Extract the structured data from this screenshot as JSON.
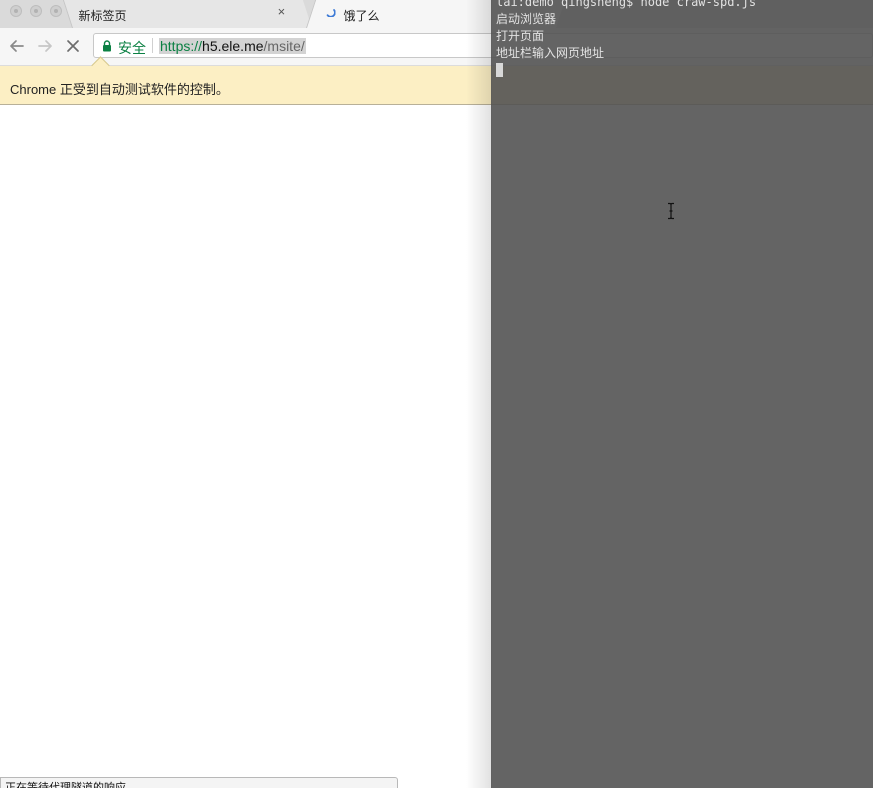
{
  "browser": {
    "tabs": [
      {
        "title": "新标签页",
        "close": "×"
      },
      {
        "title": "饿了么"
      }
    ],
    "omnibox": {
      "security_label": "安全",
      "url_scheme": "https://",
      "url_host": "h5.ele.me",
      "url_path": "/msite/"
    },
    "infobar_text": "Chrome 正受到自动测试软件的控制。",
    "status_text": "正在等待代理隧道的响应..."
  },
  "terminal": {
    "lines": [
      "lai:demo qingsheng$ node craw-spd.js",
      "启动浏览器",
      "打开页面",
      "地址栏输入网页地址"
    ]
  },
  "colors": {
    "secure_green": "#0b8043",
    "infobar_bg": "#fcefc4",
    "terminal_bg": "#5a5a5a",
    "terminal_text": "#e2e2e2"
  },
  "icons": {
    "window_controls": [
      "close-button-icon",
      "minimize-button-icon",
      "zoom-button-icon"
    ],
    "navigation": [
      "back-arrow-icon",
      "forward-arrow-icon",
      "stop-loading-icon"
    ],
    "loading": "loading-spinner-icon",
    "security": "lock-icon",
    "terminal_pointer": "text-cursor-ibeam-icon"
  }
}
